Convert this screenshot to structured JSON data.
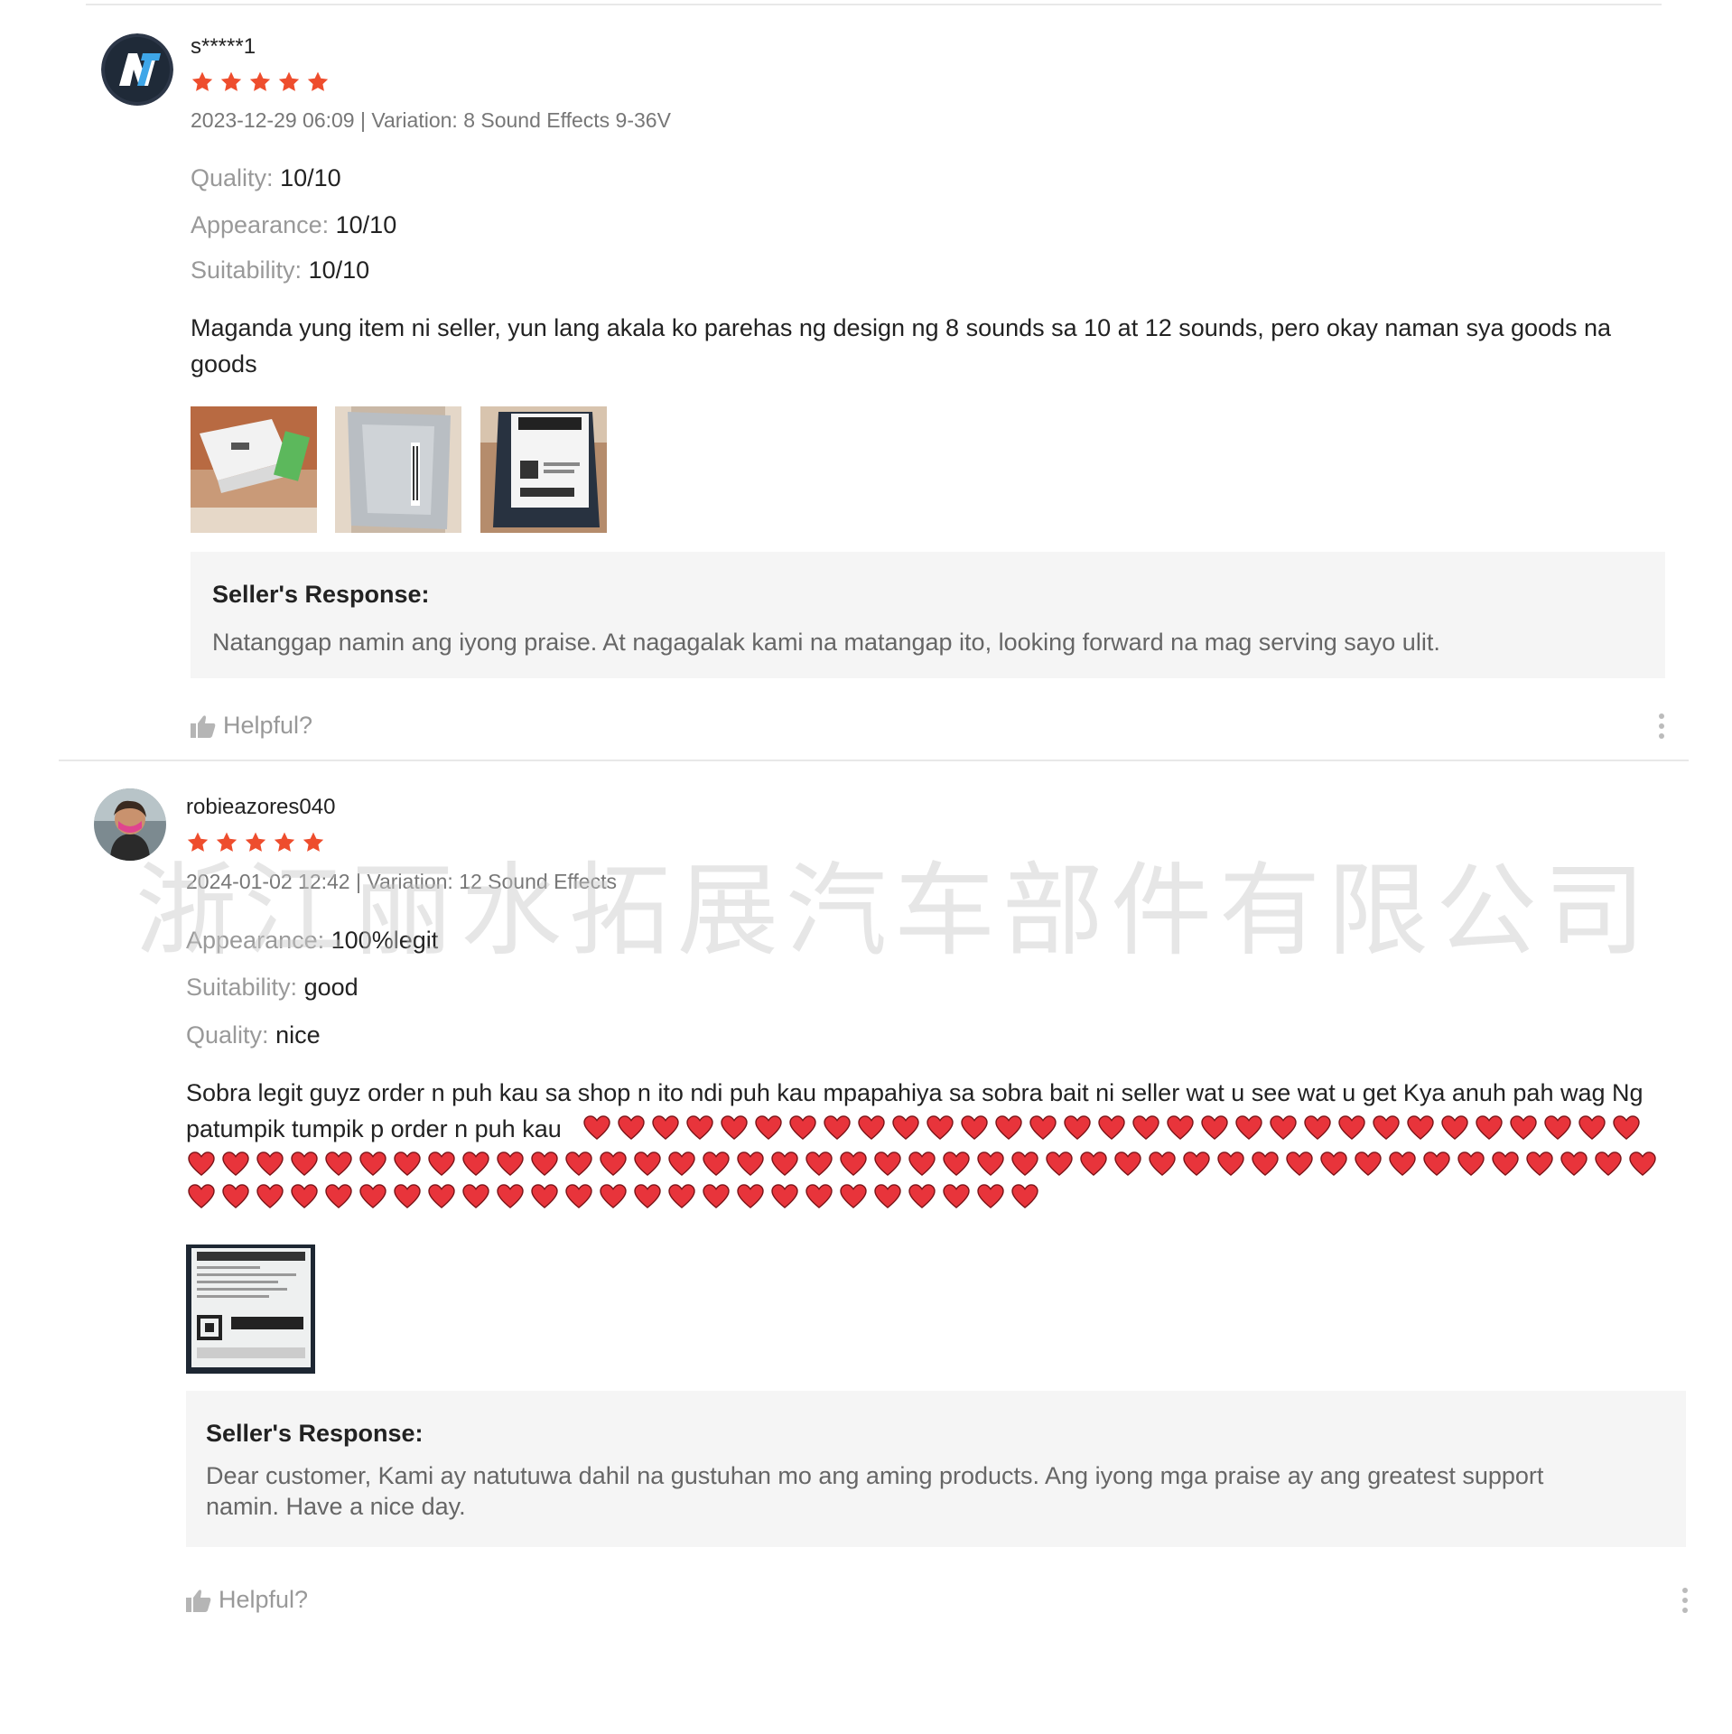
{
  "colors": {
    "star": "#ee4d2d",
    "heart": "#e8343b",
    "response_bg": "#f5f5f5",
    "divider": "#e8e8e8"
  },
  "reviews": [
    {
      "username": "s*****1",
      "rating": 5,
      "meta": "2023-12-29 06:09 | Variation: 8 Sound Effects 9-36V",
      "attributes": [
        {
          "label": "Quality:",
          "value": "10/10"
        },
        {
          "label": "Appearance:",
          "value": "10/10"
        },
        {
          "label": "Suitability:",
          "value": "10/10"
        }
      ],
      "text_line1": "Maganda yung item ni seller, yun lang akala ko parehas ng design ng 8 sounds sa 10 at 12 sounds, pero okay naman sya goods na",
      "text_line2": "goods",
      "photos": [
        "photo-box",
        "photo-package",
        "photo-label"
      ],
      "response_title": "Seller's Response:",
      "response_text": "Natanggap namin ang iyong praise. At nagagalak kami na matangap ito, looking forward na mag serving sayo ulit.",
      "helpful_label": "Helpful?"
    },
    {
      "username": "robieazores040",
      "rating": 5,
      "meta": "2024-01-02 12:42 | Variation: 12 Sound Effects",
      "attributes": [
        {
          "label": "Appearance:",
          "value": "100%legit"
        },
        {
          "label": "Suitability:",
          "value": "good"
        },
        {
          "label": "Quality:",
          "value": "nice"
        }
      ],
      "text_line1": "Sobra legit guyz order n puh kau sa shop n ito ndi puh kau mpapahiya sa sobra bait ni seller wat u see wat u get Kya anuh pah wag Ng",
      "text_line2": "patumpik tumpik p order n puh kau",
      "heart_count": 99,
      "photos": [
        "photo-shipping-label"
      ],
      "response_title": "Seller's Response:",
      "response_text": "Dear customer, Kami ay natutuwa dahil na gustuhan mo ang aming products. Ang iyong mga praise ay ang greatest support namin. Have a nice day.",
      "helpful_label": "Helpful?"
    }
  ],
  "watermark": "浙江丽水拓展汽车部件有限公司"
}
